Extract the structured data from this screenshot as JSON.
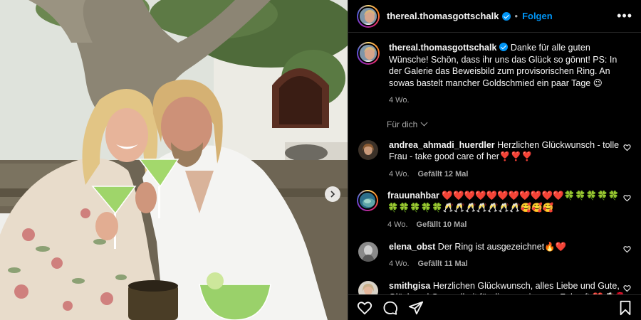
{
  "post": {
    "username": "thereal.thomasgottschalk",
    "follow_label": "Folgen",
    "separator": "•",
    "more_label": "•••",
    "caption_user": "thereal.thomasgottschalk",
    "caption_text": "Danke für alle guten Wünsche! Schön, dass ihr uns das Glück so gönnt! PS: In der Galerie das Beweisbild zum provisorischen Ring. An sowas bastelt mancher Goldschmied ein paar Tage 😉",
    "caption_time": "4 Wo.",
    "for_you_label": "Für dich"
  },
  "comments": [
    {
      "user": "andrea_ahmadi_huerdler",
      "text": "Herzlichen Glückwunsch - tolle Frau - take good care of her❣️❣️❣️",
      "time": "4 Wo.",
      "likes": "Gefällt 12 Mal"
    },
    {
      "user": "frauunahbar",
      "text": "❤️❤️❤️❤️❤️❤️❤️❤️❤️❤️❤️🍀🍀🍀🍀🍀🍀🍀🍀🍀🍀🥂🥂🥂🥂🥂🥂🥂🥰🥰🥰",
      "time": "4 Wo.",
      "likes": "Gefällt 10 Mal"
    },
    {
      "user": "elena_obst",
      "text": "Der Ring ist ausgezeichnet🔥❤️",
      "time": "4 Wo.",
      "likes": "Gefällt 11 Mal"
    },
    {
      "user": "smithgisa",
      "text": "Herzlichen Glückwunsch, alles Liebe und Gute, Glück und Gesundheit für die gemeinsame Zukunft.❤️🥂🌹",
      "time": "",
      "likes": ""
    }
  ],
  "icons": {
    "like": "heart-icon",
    "comment": "comment-icon",
    "share": "paper-plane-icon",
    "save": "bookmark-icon",
    "next": "chevron-right-icon"
  },
  "colors": {
    "background": "#000000",
    "accent": "#0095f6",
    "secondary_text": "#a8a8a8",
    "border": "#262626"
  }
}
